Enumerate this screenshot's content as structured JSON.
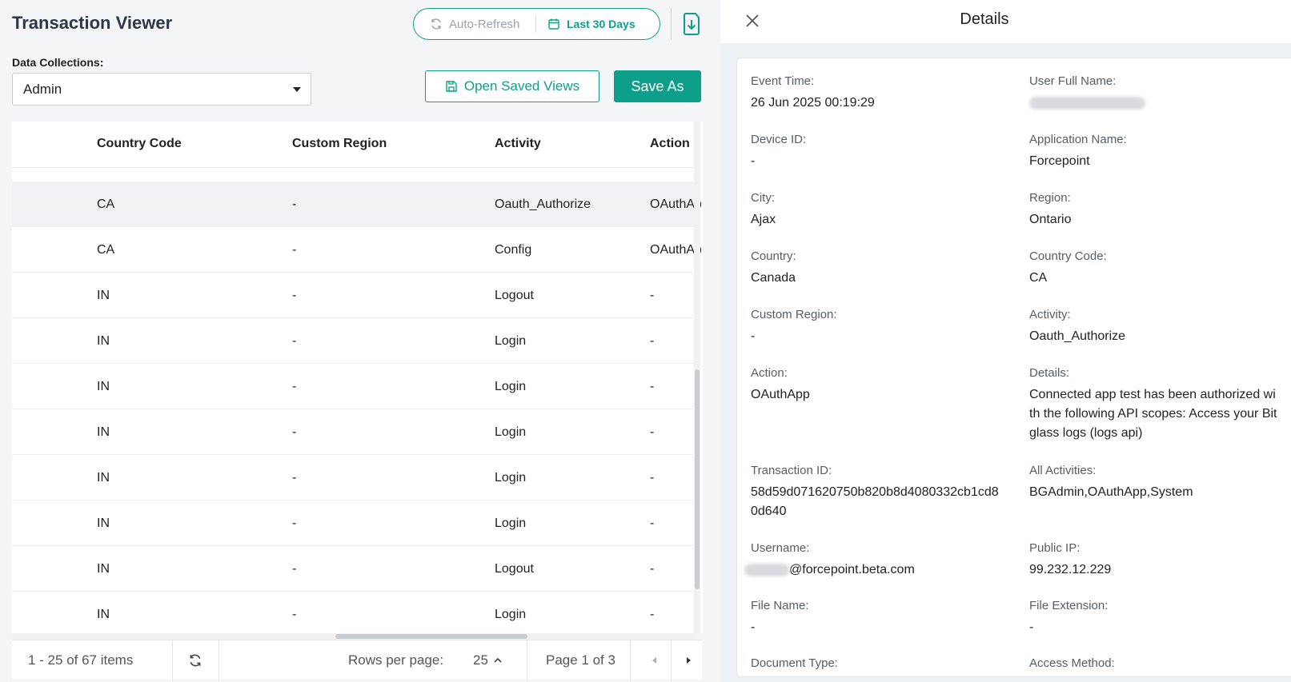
{
  "app": {
    "title": "Transaction Viewer",
    "auto_refresh": "Auto-Refresh",
    "date_range": "Last 30 Days"
  },
  "filters": {
    "data_collections_label": "Data Collections:",
    "data_collection_value": "Admin",
    "open_saved_views": "Open Saved Views",
    "save_as": "Save As"
  },
  "table": {
    "columns": [
      "Country Code",
      "Custom Region",
      "Activity",
      "Action"
    ],
    "rows": [
      {
        "country": "CA",
        "region": "-",
        "activity": "Oauth_Authorize",
        "action": "OAuthApp",
        "selected": true
      },
      {
        "country": "CA",
        "region": "-",
        "activity": "Config",
        "action": "OAuthApp"
      },
      {
        "country": "IN",
        "region": "-",
        "activity": "Logout",
        "action": "-"
      },
      {
        "country": "IN",
        "region": "-",
        "activity": "Login",
        "action": "-"
      },
      {
        "country": "IN",
        "region": "-",
        "activity": "Login",
        "action": "-"
      },
      {
        "country": "IN",
        "region": "-",
        "activity": "Login",
        "action": "-"
      },
      {
        "country": "IN",
        "region": "-",
        "activity": "Login",
        "action": "-"
      },
      {
        "country": "IN",
        "region": "-",
        "activity": "Login",
        "action": "-"
      },
      {
        "country": "IN",
        "region": "-",
        "activity": "Logout",
        "action": "-"
      },
      {
        "country": "IN",
        "region": "-",
        "activity": "Login",
        "action": "-"
      }
    ]
  },
  "pagination": {
    "items_text": "1 - 25 of 67 items",
    "rows_per_page_label": "Rows per page:",
    "rows_per_page_value": "25",
    "page_text": "Page 1 of 3"
  },
  "details": {
    "title": "Details",
    "fields": {
      "event_time": {
        "label": "Event Time:",
        "value": "26 Jun 2025 00:19:29"
      },
      "user_full_name": {
        "label": "User Full Name:",
        "value": ""
      },
      "device_id": {
        "label": "Device ID:",
        "value": "-"
      },
      "application_name": {
        "label": "Application Name:",
        "value": "Forcepoint"
      },
      "city": {
        "label": "City:",
        "value": "Ajax"
      },
      "region": {
        "label": "Region:",
        "value": "Ontario"
      },
      "country": {
        "label": "Country:",
        "value": "Canada"
      },
      "country_code": {
        "label": "Country Code:",
        "value": "CA"
      },
      "custom_region": {
        "label": "Custom Region:",
        "value": "-"
      },
      "activity": {
        "label": "Activity:",
        "value": "Oauth_Authorize"
      },
      "action": {
        "label": "Action:",
        "value": "OAuthApp"
      },
      "details": {
        "label": "Details:",
        "value": "Connected app test has been authorized with the following API scopes: Access your Bitglass logs (logs api)"
      },
      "transaction_id": {
        "label": "Transaction ID:",
        "value": "58d59d071620750b820b8d4080332cb1cd80d640"
      },
      "all_activities": {
        "label": "All Activities:",
        "value": "BGAdmin,OAuthApp,System"
      },
      "username": {
        "label": "Username:",
        "value": "@forcepoint.beta.com"
      },
      "public_ip": {
        "label": "Public IP:",
        "value": "99.232.12.229"
      },
      "file_name": {
        "label": "File Name:",
        "value": "-"
      },
      "file_extension": {
        "label": "File Extension:",
        "value": "-"
      },
      "document_type": {
        "label": "Document Type:",
        "value": ""
      },
      "access_method": {
        "label": "Access Method:",
        "value": ""
      }
    }
  },
  "colors": {
    "accent": "#0e9f8a",
    "selected_row": "#f0f2f4"
  }
}
